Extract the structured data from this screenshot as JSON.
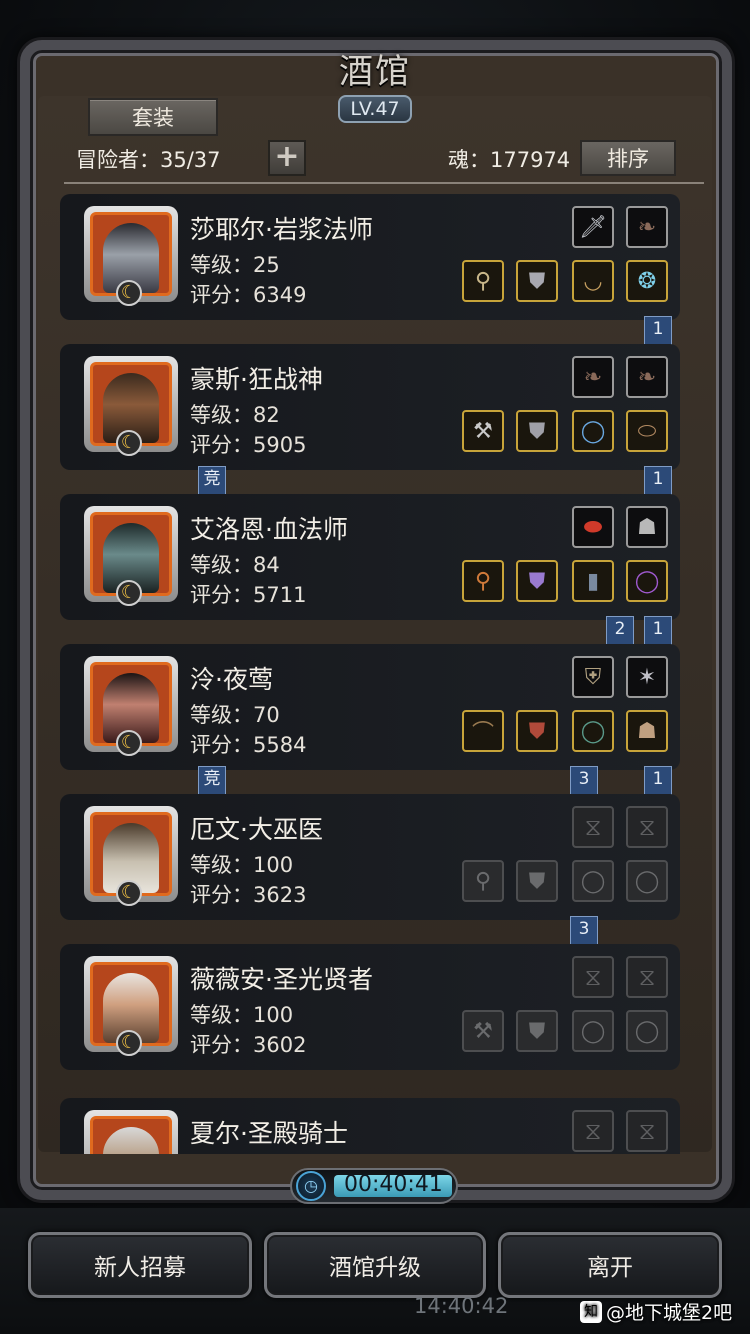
{
  "header": {
    "title": "酒馆",
    "level": "LV.47",
    "set_label": "套装",
    "adventurer_label": "冒险者：35/37",
    "add_label": "+",
    "soul_label": "魂：177974",
    "sort_label": "排序"
  },
  "heroes": [
    {
      "name": "莎耶尔·岩浆法师",
      "level": "等级：25",
      "score": "评分：6349"
    },
    {
      "name": "豪斯·狂战神",
      "level": "等级：82",
      "score": "评分：5905"
    },
    {
      "name": "艾洛恩·血法师",
      "level": "等级：84",
      "score": "评分：5711"
    },
    {
      "name": "泠·夜莺",
      "level": "等级：70",
      "score": "评分：5584"
    },
    {
      "name": "厄文·大巫医",
      "level": "等级：100",
      "score": "评分：3623"
    },
    {
      "name": "薇薇安·圣光贤者",
      "level": "等级：100",
      "score": "评分：3602"
    },
    {
      "name": "夏尔·圣殿骑士",
      "level": "",
      "score": ""
    }
  ],
  "ribbons": {
    "r1": "1",
    "r2a": "竞",
    "r2b": "1",
    "r3a": "2",
    "r3b": "1",
    "r4a": "竞",
    "r4b": "3",
    "r4c": "1",
    "r5": "3"
  },
  "timer": "00:40:41",
  "buttons": {
    "recruit": "新人招募",
    "upgrade": "酒馆升级",
    "leave": "离开"
  },
  "clock": "14:40:42",
  "watermark": "@地下城堡2吧",
  "watermark_icon": "知",
  "colors": {
    "gold_border": "#c7a43a",
    "portrait_orange": "#b5461c",
    "ribbon_blue": "#2c4a78"
  }
}
